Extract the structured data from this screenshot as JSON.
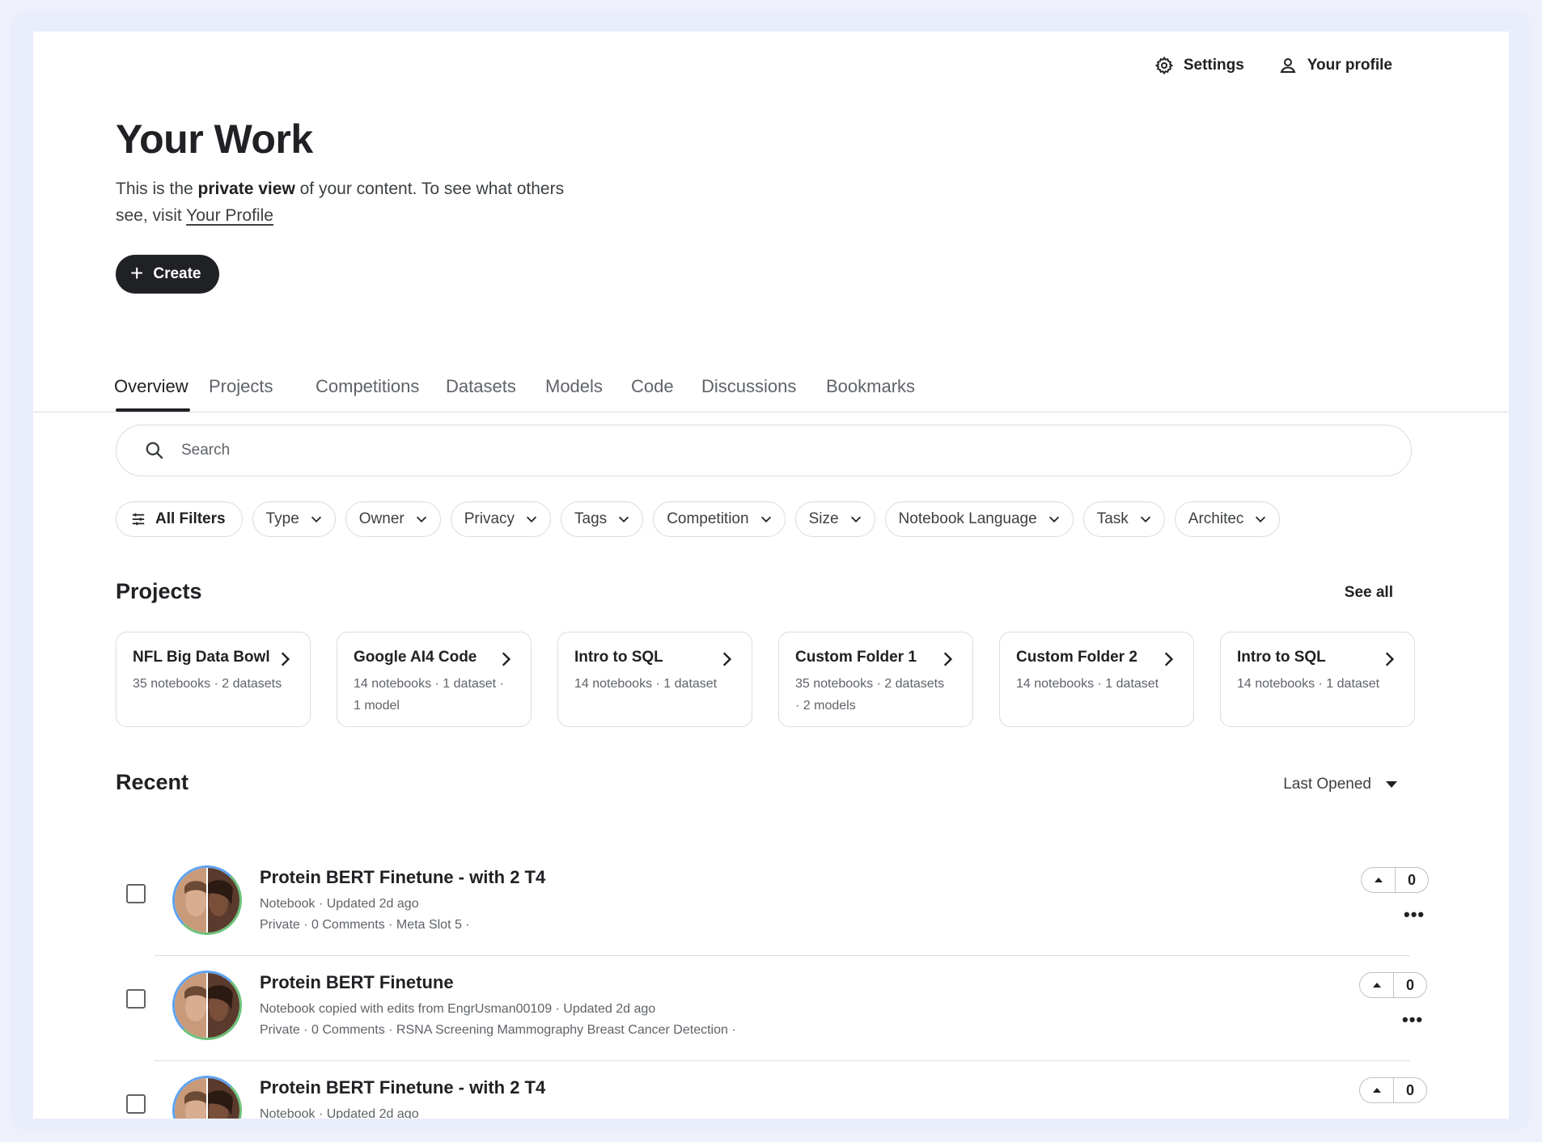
{
  "header": {
    "settings_label": "Settings",
    "profile_label": "Your profile"
  },
  "page": {
    "title": "Your Work",
    "subtitle_pre": "This is the ",
    "subtitle_bold": "private view",
    "subtitle_mid": " of your content. To see what others see, visit ",
    "subtitle_link": "Your Profile",
    "create_label": "Create"
  },
  "tabs": [
    {
      "label": "Overview",
      "active": true
    },
    {
      "label": "Projects"
    },
    {
      "label": "Competitions"
    },
    {
      "label": "Datasets"
    },
    {
      "label": "Models"
    },
    {
      "label": "Code"
    },
    {
      "label": "Discussions"
    },
    {
      "label": "Bookmarks"
    }
  ],
  "search": {
    "placeholder": "Search"
  },
  "filters": {
    "all_filters": "All Filters",
    "chips": [
      "Type",
      "Owner",
      "Privacy",
      "Tags",
      "Competition",
      "Size",
      "Notebook Language",
      "Task",
      "Architec"
    ]
  },
  "projects": {
    "title": "Projects",
    "see_all": "See all",
    "cards": [
      {
        "name": "NFL Big Data Bowl",
        "meta": "35 notebooks · 2 datasets"
      },
      {
        "name": "Google AI4 Code",
        "meta": "14 notebooks · 1 dataset · 1 model"
      },
      {
        "name": "Intro to SQL",
        "meta": "14 notebooks · 1 dataset"
      },
      {
        "name": "Custom Folder 1",
        "meta": "35 notebooks · 2 datasets · 2 models"
      },
      {
        "name": "Custom Folder 2",
        "meta": "14 notebooks · 1 dataset"
      },
      {
        "name": "Intro to SQL",
        "meta": "14 notebooks · 1 dataset"
      }
    ]
  },
  "recent": {
    "title": "Recent",
    "sort_label": "Last Opened",
    "items": [
      {
        "title": "Protein BERT Finetune - with 2 T4",
        "line1": "Notebook · Updated 2d ago",
        "line2": "Private · 0 Comments · Meta Slot 5 ·",
        "votes": "0"
      },
      {
        "title": "Protein BERT Finetune",
        "line1": "Notebook copied with edits from EngrUsman00109 · Updated 2d ago",
        "line2": "Private · 0 Comments · RSNA Screening Mammography Breast Cancer Detection ·",
        "votes": "0"
      },
      {
        "title": "Protein BERT Finetune - with 2 T4",
        "line1": "Notebook · Updated 2d ago",
        "line2": "",
        "votes": "0"
      }
    ],
    "more_label": "•••"
  },
  "icons": {
    "settings": "gear-icon",
    "profile": "person-icon",
    "search": "search-icon",
    "filters": "sliders-icon",
    "chevron": "chevron-down-icon",
    "arrow": "chevron-right-icon"
  }
}
